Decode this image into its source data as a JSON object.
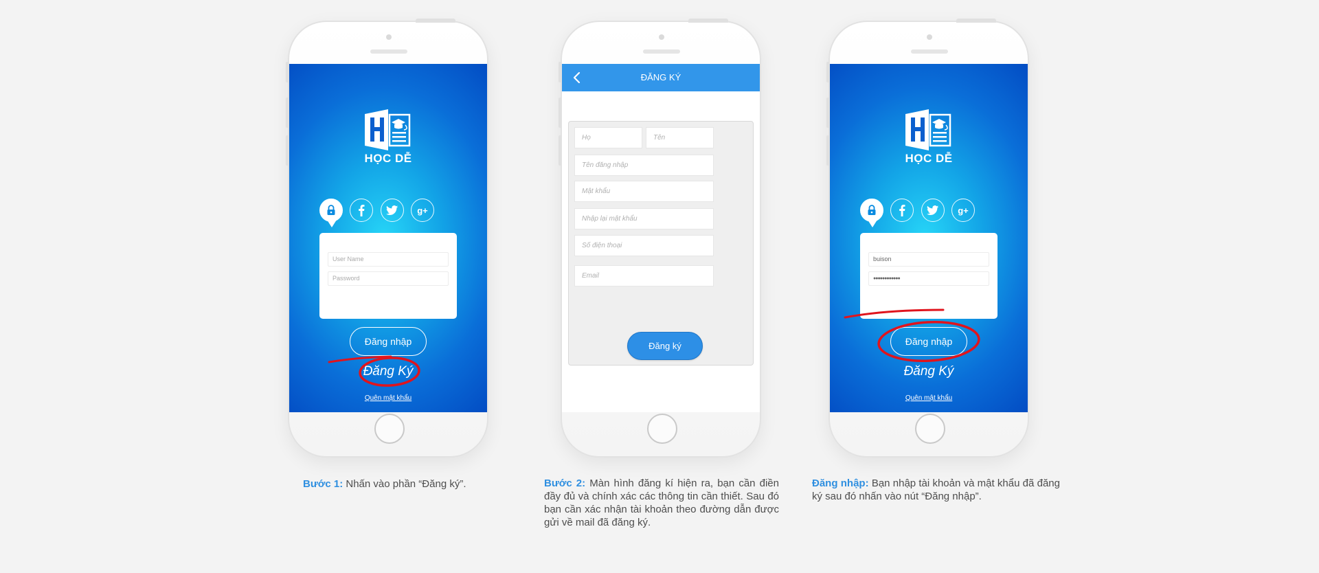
{
  "colors": {
    "accent": "#2f8fe0",
    "header_blue": "#3296ea",
    "highlight_red": "#e0141d",
    "background": "#f3f3f3",
    "caption_text": "#4d4d4d"
  },
  "phone1": {
    "logo_text": "HỌC DỄ",
    "social_icons": [
      "lock-icon",
      "facebook-icon",
      "twitter-icon",
      "google-plus-icon"
    ],
    "username_placeholder": "User Name",
    "password_placeholder": "Password",
    "login_button": "Đăng nhập",
    "register_link": "Đăng Ký",
    "forgot_link": "Quên mật khẩu",
    "highlighted": "register_link"
  },
  "phone2": {
    "header_title": "ĐĂNG KÝ",
    "fields": {
      "last_name": "Họ",
      "first_name": "Tên",
      "username": "Tên đăng nhập",
      "password": "Mật khẩu",
      "confirm_password": "Nhập lại mật khẩu",
      "phone": "Số điện thoại",
      "email": "Email"
    },
    "submit_button": "Đăng ký"
  },
  "phone3": {
    "logo_text": "HỌC DỄ",
    "social_icons": [
      "lock-icon",
      "facebook-icon",
      "twitter-icon",
      "google-plus-icon"
    ],
    "username_value": "buison",
    "password_value": "●●●●●●●●●●●●",
    "login_button": "Đăng nhập",
    "register_link": "Đăng Ký",
    "forgot_link": "Quên mật khẩu",
    "highlighted": "login_button"
  },
  "captions": [
    {
      "step": "Bước 1:",
      "text": " Nhấn vào phần “Đăng ký”."
    },
    {
      "step": "Bước 2:",
      "text": " Màn hình đăng kí hiện ra, bạn cần điền đầy đủ và chính xác các thông tin cần thiết. Sau đó bạn cần xác nhận tài khoản theo đường dẫn được gửi về mail đã đăng ký."
    },
    {
      "step": "Đăng nhập:",
      "text": " Bạn nhập tài khoản và mật khẩu đã đăng ký sau đó nhấn vào nút “Đăng nhập”."
    }
  ]
}
